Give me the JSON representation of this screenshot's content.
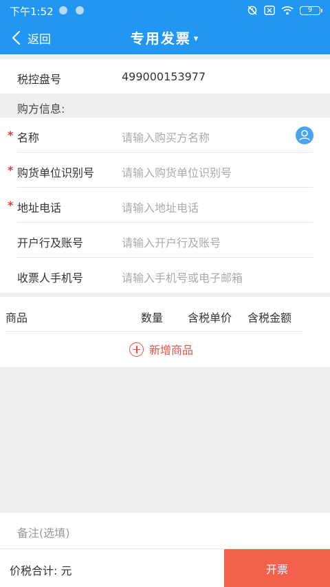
{
  "status": {
    "time": "下午1:52",
    "battery": "9"
  },
  "nav": {
    "back_label": "返回",
    "title": "专用发票",
    "caret": "▾"
  },
  "device": {
    "label": "税控盘号",
    "value": "499000153977"
  },
  "buyer_section": "购方信息:",
  "fields": [
    {
      "label": "名称",
      "required": true,
      "placeholder": "请输入购买方名称"
    },
    {
      "label": "购货单位识别号",
      "required": true,
      "placeholder": "请输入购货单位识别号"
    },
    {
      "label": "地址电话",
      "required": true,
      "placeholder": "请输入地址电话"
    },
    {
      "label": "开户行及账号",
      "required": false,
      "placeholder": "请输入开户行及账号"
    },
    {
      "label": "收票人手机号",
      "required": false,
      "placeholder": "请输入手机号或电子邮箱"
    }
  ],
  "required_mark": "*",
  "goods": {
    "columns": [
      "商品",
      "数量",
      "含税单价",
      "含税金额"
    ],
    "add_label": "新增商品"
  },
  "remark_placeholder": "备注(选填)",
  "footer": {
    "total_label": "价税合计: 元",
    "submit_label": "开票"
  },
  "colors": {
    "primary": "#2196f3",
    "accent": "#f4614d",
    "required": "#e53935"
  }
}
